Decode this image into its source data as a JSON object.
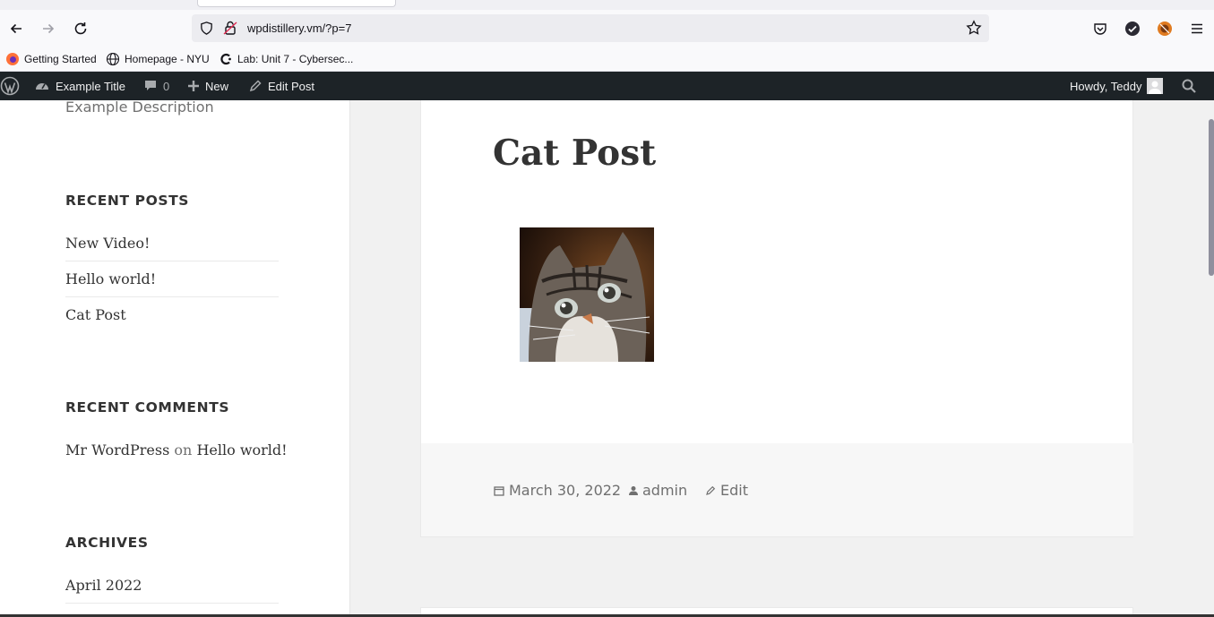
{
  "browser": {
    "url": "wpdistillery.vm/?p=7",
    "bookmarks": [
      {
        "label": "Getting Started",
        "icon": "firefox-icon"
      },
      {
        "label": "Homepage - NYU",
        "icon": "globe-icon"
      },
      {
        "label": "Lab: Unit 7 - Cybersec...",
        "icon": "c-logo-icon"
      }
    ]
  },
  "adminbar": {
    "site_name": "Example Title",
    "comments_count": "0",
    "new_label": "New",
    "edit_label": "Edit Post",
    "howdy": "Howdy, Teddy"
  },
  "sidebar": {
    "description": "Example Description",
    "recent_posts_title": "RECENT POSTS",
    "recent_posts": [
      "New Video!",
      "Hello world!",
      "Cat Post"
    ],
    "recent_comments_title": "RECENT COMMENTS",
    "comment_author": "Mr WordPress",
    "comment_on": "on",
    "comment_post": "Hello world!",
    "archives_title": "ARCHIVES",
    "archives": [
      "April 2022"
    ]
  },
  "post": {
    "title": "Cat Post",
    "date": "March 30, 2022",
    "author": "admin",
    "edit": "Edit"
  },
  "colors": {
    "adminbar_bg": "#1d2327",
    "text": "#333333",
    "meta": "#707070"
  }
}
